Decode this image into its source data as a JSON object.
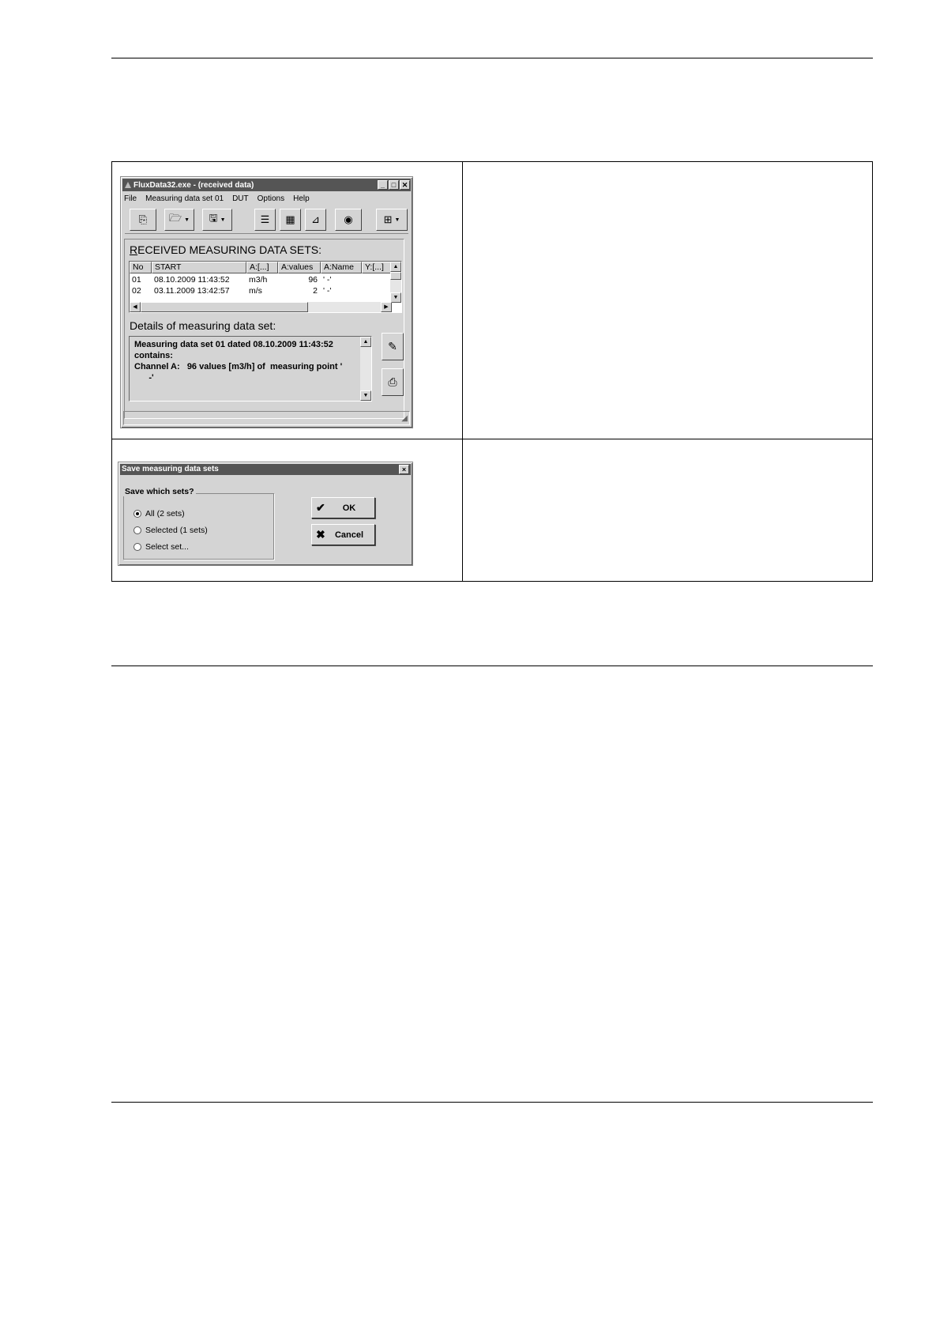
{
  "main_window": {
    "title": "FluxData32.exe - (received data)",
    "caption_buttons": [
      "_",
      "□",
      "✕"
    ],
    "menu": [
      "File",
      "Measuring data set 01",
      "DUT",
      "Options",
      "Help"
    ],
    "toolbar_icons": [
      "connect-icon",
      "open-folder-icon",
      "save-disk-icon",
      "list-view-icon",
      "table-view-icon",
      "chart-view-icon",
      "eye-icon",
      "grid-options-icon"
    ],
    "received_heading_first": "R",
    "received_heading_rest": "ECEIVED MEASURING DATA SETS:",
    "columns": [
      "No",
      "START",
      "A:[...]",
      "A:values",
      "A:Name",
      "Y:[...]"
    ],
    "rows": [
      {
        "no": "01",
        "start": "08.10.2009  11:43:52",
        "unit": "m3/h",
        "values": "96",
        "name": "'       -'"
      },
      {
        "no": "02",
        "start": "03.11.2009  13:42:57",
        "unit": "m/s",
        "values": "2",
        "name": "'       -'"
      }
    ],
    "details_heading": "Details of measuring data set:",
    "details_lines": [
      "Measuring data set 01 dated 08.10.2009  11:43:52",
      "contains:",
      "Channel A:   96 values [m3/h] of  measuring point '",
      "      -'"
    ]
  },
  "save_dialog": {
    "title": "Save measuring data sets",
    "close": "×",
    "group_label": "Save which sets?",
    "options": [
      {
        "label": "All (2 sets)",
        "selected": true
      },
      {
        "label": "Selected (1 sets)",
        "selected": false
      },
      {
        "label": "Select set...",
        "selected": false
      }
    ],
    "ok_label": "OK",
    "cancel_label": "Cancel"
  }
}
